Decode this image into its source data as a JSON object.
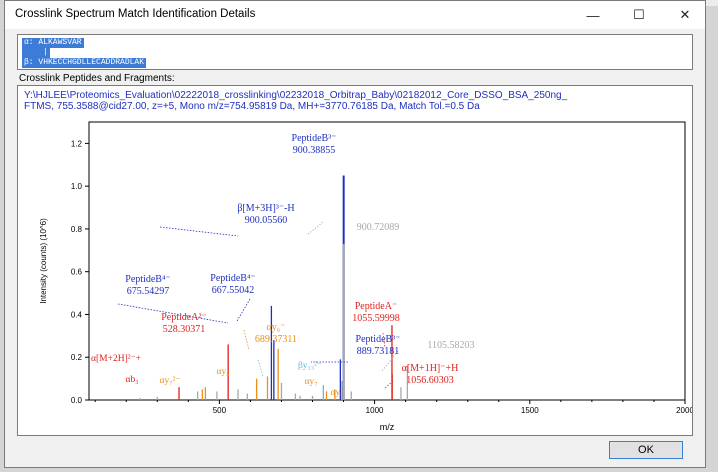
{
  "window": {
    "title": "Crosslink Spectrum Match Identification Details",
    "minimize_glyph": "—",
    "maximize_glyph": "☐",
    "close_glyph": "✕"
  },
  "sequence": {
    "alpha": "α: ALKAWSVAR",
    "link": "    |",
    "beta": "β: VHKECCHGDLLECADDRADLAK"
  },
  "group_label": "Crosslink Peptides and Fragments:",
  "header": {
    "line1": "Y:\\HJLEE\\Proteomics_Evaluation\\02222018_crosslinking\\02232018_Orbitrap_Baby\\02182012_Core_DSSO_BSA_250ng_",
    "line2": "FTMS, 755.3588@cid27.00, z=+5, Mono m/z=754.95819 Da, MH+=3770.76185 Da, Match Tol.=0.5 Da"
  },
  "ok_label": "OK",
  "colors": {
    "blue": "#1f2fbf",
    "red": "#e0201c",
    "orange": "#e8901a",
    "gray": "#a8a8a8",
    "cyan": "#63b8e8"
  },
  "chart_data": {
    "type": "bar",
    "xlabel": "m/z",
    "ylabel": "Intensity (counts) (10^6)",
    "xlim": [
      80,
      2000
    ],
    "ylim": [
      0,
      1.3
    ],
    "xticks": [
      500,
      1000,
      1500,
      2000
    ],
    "yticks": [
      0.0,
      0.2,
      0.4,
      0.6,
      0.8,
      1.0,
      1.2
    ],
    "peaks": [
      {
        "x": 245,
        "y": 0.01,
        "color": "gray"
      },
      {
        "x": 300,
        "y": 0.015,
        "color": "gray"
      },
      {
        "x": 370,
        "y": 0.06,
        "color": "red"
      },
      {
        "x": 430,
        "y": 0.04,
        "color": "gray"
      },
      {
        "x": 445,
        "y": 0.05,
        "color": "orange"
      },
      {
        "x": 455,
        "y": 0.06,
        "color": "orange"
      },
      {
        "x": 492,
        "y": 0.04,
        "color": "gray"
      },
      {
        "x": 528.3,
        "y": 0.26,
        "color": "red"
      },
      {
        "x": 560,
        "y": 0.05,
        "color": "gray"
      },
      {
        "x": 590,
        "y": 0.03,
        "color": "gray"
      },
      {
        "x": 620,
        "y": 0.1,
        "color": "orange"
      },
      {
        "x": 655,
        "y": 0.11,
        "color": "orange"
      },
      {
        "x": 667.6,
        "y": 0.44,
        "color": "blue"
      },
      {
        "x": 675.5,
        "y": 0.28,
        "color": "blue"
      },
      {
        "x": 689.4,
        "y": 0.24,
        "color": "orange"
      },
      {
        "x": 700,
        "y": 0.08,
        "color": "gray"
      },
      {
        "x": 745,
        "y": 0.03,
        "color": "gray"
      },
      {
        "x": 760,
        "y": 0.02,
        "color": "gray"
      },
      {
        "x": 800,
        "y": 0.02,
        "color": "gray"
      },
      {
        "x": 835,
        "y": 0.07,
        "color": "cyan"
      },
      {
        "x": 845,
        "y": 0.04,
        "color": "orange"
      },
      {
        "x": 872,
        "y": 0.05,
        "color": "orange"
      },
      {
        "x": 889.7,
        "y": 0.19,
        "color": "blue"
      },
      {
        "x": 895,
        "y": 0.09,
        "color": "gray"
      },
      {
        "x": 900.4,
        "y": 1.05,
        "color": "blue"
      },
      {
        "x": 900.7,
        "y": 0.73,
        "color": "gray"
      },
      {
        "x": 925,
        "y": 0.04,
        "color": "gray"
      },
      {
        "x": 1056.0,
        "y": 0.35,
        "color": "red"
      },
      {
        "x": 1056.6,
        "y": 0.12,
        "color": "red"
      },
      {
        "x": 1085,
        "y": 0.06,
        "color": "gray"
      },
      {
        "x": 1105.6,
        "y": 0.16,
        "color": "gray"
      }
    ],
    "annotations": [
      {
        "label": "PeptideB³⁻",
        "mz": "900.38855",
        "color": "blue"
      },
      {
        "label": "β[M+3H]³⁻-H",
        "mz": "900.05560",
        "color": "blue"
      },
      {
        "label": "",
        "mz": "900.72089",
        "color": "gray"
      },
      {
        "label": "PeptideB⁴⁻",
        "mz": "675.54297",
        "color": "blue"
      },
      {
        "label": "PeptideB⁴⁻",
        "mz": "667.55042",
        "color": "blue"
      },
      {
        "label": "PeptideA⁻",
        "mz": "1055.59998",
        "color": "red"
      },
      {
        "label": "PeptideA²⁻",
        "mz": "528.30371",
        "color": "red"
      },
      {
        "label": "αy₆⁻",
        "mz": "689.37311",
        "color": "orange"
      },
      {
        "label": "PeptideB³⁻",
        "mz": "889.73181",
        "color": "blue"
      },
      {
        "label": "",
        "mz": "1105.58203",
        "color": "gray"
      },
      {
        "label": "α[M+2H]²⁻+",
        "mz": "",
        "color": "red"
      },
      {
        "label": "α[M+1H]⁻+H",
        "mz": "1056.60303",
        "color": "red"
      },
      {
        "label": "βy₁₃²⁻",
        "mz": "",
        "color": "cyan"
      },
      {
        "label": "αb₃",
        "mz": "",
        "color": "red"
      },
      {
        "label": "αy₇²⁻",
        "mz": "",
        "color": "orange"
      },
      {
        "label": "αy₅",
        "mz": "",
        "color": "orange"
      },
      {
        "label": "αy₇",
        "mz": "",
        "color": "orange"
      },
      {
        "label": "αy₇",
        "mz": "",
        "color": "orange"
      }
    ]
  }
}
